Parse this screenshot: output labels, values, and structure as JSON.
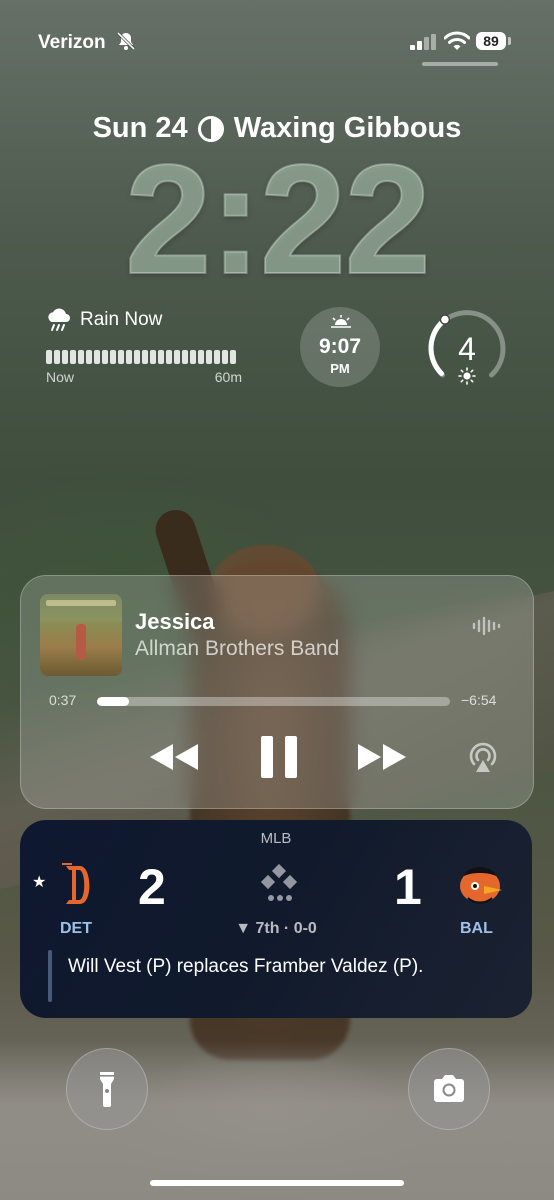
{
  "status_bar": {
    "carrier": "Verizon",
    "battery": "89",
    "icons": [
      "bell-slash-icon",
      "cellular-signal-icon",
      "wifi-icon",
      "battery-icon"
    ]
  },
  "lock_screen": {
    "date": "Sun 24",
    "moon_phase": "Waxing Gibbous",
    "time": "2:22"
  },
  "widgets": {
    "rain": {
      "title": "Rain Now",
      "start_label": "Now",
      "end_label": "60m",
      "icon": "cloud-rain-icon"
    },
    "sunset": {
      "time": "9:07",
      "ampm": "PM",
      "icon": "sunset-icon"
    },
    "uv_index": {
      "value": "4",
      "level_fraction": 0.36,
      "icon": "sun-icon"
    }
  },
  "now_playing": {
    "song": "Jessica",
    "artist": "Allman Brothers Band",
    "elapsed": "0:37",
    "remaining": "−6:54",
    "progress_fraction": 0.09,
    "icons": [
      "album-art",
      "waveform-icon",
      "rewind-icon",
      "pause-icon",
      "fast-forward-icon",
      "airplay-icon"
    ]
  },
  "score": {
    "league": "MLB",
    "favorite": "★",
    "home": {
      "abbr": "DET",
      "score": "2",
      "color": "#e4682d"
    },
    "away": {
      "abbr": "BAL",
      "score": "1",
      "color": "#e4682d"
    },
    "inning": "▼ 7th · 0-0",
    "last_play": "Will Vest (P) replaces Framber Valdez (P)."
  },
  "bottom": {
    "left_button": "flashlight-icon",
    "right_button": "camera-icon"
  },
  "colors": {
    "score_card_bg": "#0e1830",
    "team_abbr": "#9fc1e8",
    "team_logo": "#e4682d"
  }
}
